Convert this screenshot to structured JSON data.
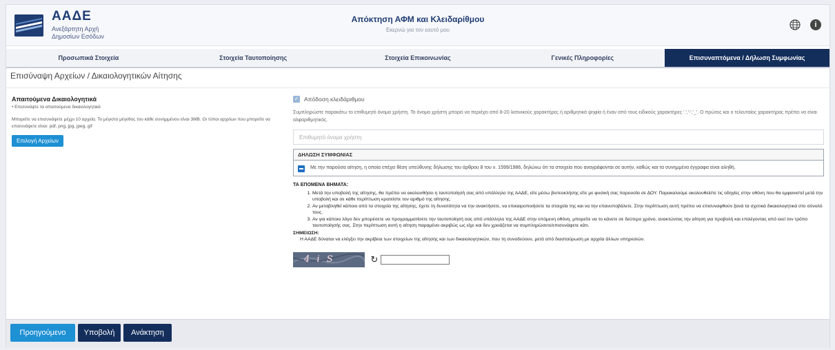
{
  "header": {
    "logo_title": "ΑΑΔΕ",
    "logo_subtitle_1": "Ανεξάρτητη Αρχή",
    "logo_subtitle_2": "Δημοσίων Εσόδων",
    "app_title": "Απόκτηση ΑΦΜ και Κλειδαρίθμου",
    "app_subtitle": "Εκερνώ για τον εαυτό μου",
    "icons": [
      "globe-icon",
      "info-icon"
    ],
    "info_symbol": "i"
  },
  "tabs": [
    {
      "label": "Προσωπικά Στοιχεία",
      "active": false
    },
    {
      "label": "Στοιχεία Ταυτοποίησης",
      "active": false
    },
    {
      "label": "Στοιχεία Επικοινωνίας",
      "active": false
    },
    {
      "label": "Γενικές Πληροφορίες",
      "active": false
    },
    {
      "label": "Επισυναπτόμενα / Δήλωση Συμφωνίας",
      "active": true
    }
  ],
  "section_title": "Επισύναψη Αρχείων / Δικαιολογητικών Αίτησης",
  "left": {
    "heading": "Απαιτούμενα Δικαιολογητικά",
    "bullet": "• Επισυνάψτε τα απαιτούμενα δικαιολογητικά",
    "description": "Μπορείτε να επισυνάψετε μέχρι 10 αρχεία. Το μέγιστο μέγεθος του κάθε συνημμένου είναι 3MB. Οι τύποι αρχείων που μπορείτε να επισυνάψετε είναι: pdf, png, jpg, jpeg, gif",
    "select_button": "Επιλογή Αρχείων"
  },
  "right": {
    "key_checkbox_label": "Απόδοση κλειδάριθμου",
    "key_checkbox_checked": true,
    "username_hint": "Συμπληρώστε παρακάτω το επιθυμητό όνομα χρήστη. Το όνομα χρήστη μπορεί να περιέχει από 8-20 λατινικούς χαρακτήρες ή αριθμητικά ψηφία ή έναν από τους ειδικούς χαρακτήρες '.','-','_'. Ο πρώτος και ο τελευταίος χαρακτήρας πρέπει να είναι αλφαριθμητικός.",
    "username_placeholder": "Επιθυμητό όνομα χρήστη",
    "consent_heading": "ΔΗΛΩΣΗ ΣΥΜΦΩΝΙΑΣ",
    "consent_text": "Με την παρούσα αίτηση, η οποία επέχει θέση υπεύθυνης δήλωσης του άρθρου 8 του ν. 1599/1986, δηλώνω ότι τα στοιχεία που αναγράφονται σε αυτήν, καθώς και τα συνημμένα έγγραφα είναι αληθή.",
    "next_steps_heading": "ΤΑ ΕΠΟΜΕΝΑ ΒΗΜΑΤΑ:",
    "next_steps": [
      "Μετά την υποβολή της αίτησης, θα πρέπει να ακολουθήσει η ταυτοποίησή σας από υπάλληλο της ΑΑΔΕ, είτε μέσω βιντεοκλήσης είτε με φυσική σας παρουσία σε ΔΟΥ. Παρακαλούμε ακολουθείστε τις οδηγίες στην οθόνη που θα εμφανιστεί μετά την υποβολή και σε κάθε περίπτωση κρατείστε τον αριθμό της αίτησης.",
      "Αν μεταβληθεί κάποιο από τα στοιχεία της αίτησης, έχετε τη δυνατότητα να την ανακτήσετε, να επικαιροποιήσετε τα στοιχεία της και να την επανυποβάλετε. Στην περίπτωση αυτή πρέπει να επισυναφθούν ξανά τα σχετικά δικαιολογητικά στο σύνολό τους.",
      "Αν για κάποιο λόγο δεν μπορέσετε να προγραμματίσετε την ταυτοποίησή σας από υπάλληλο της ΑΑΔΕ στην επόμενη οθόνη, μπορείτε να το κάνετε σε δεύτερο χρόνο, ανακτώντας την αίτηση για προβολή και επιλέγοντας από εκεί τον τρόπο ταυτοποίησής σας. Στην περίπτωση αυτή η αίτηση παραμένει ακριβώς ως είχε και δεν χρειάζεται να συμπληρώσετε/επισυνάψετε κάτι."
    ],
    "note_heading": "ΣΗΜΕΙΩΣΗ:",
    "note_text": "Η ΑΑΔΕ δύναται να ελέγξει την ακρίβεια των στοιχείων της αίτησης και των δικαιολογητικών, που τη συνοδεύουν, μετά από διασταύρωση με αρχεία άλλων υπηρεσιών.",
    "captcha_text": "4 i S",
    "refresh_symbol": "↻"
  },
  "footer": {
    "prev_button": "Προηγούμενο",
    "submit_button": "Υποβολή",
    "recover_button": "Ανάκτηση"
  },
  "colors": {
    "brand_navy": "#142e5c",
    "accent_blue": "#1e90d4"
  }
}
